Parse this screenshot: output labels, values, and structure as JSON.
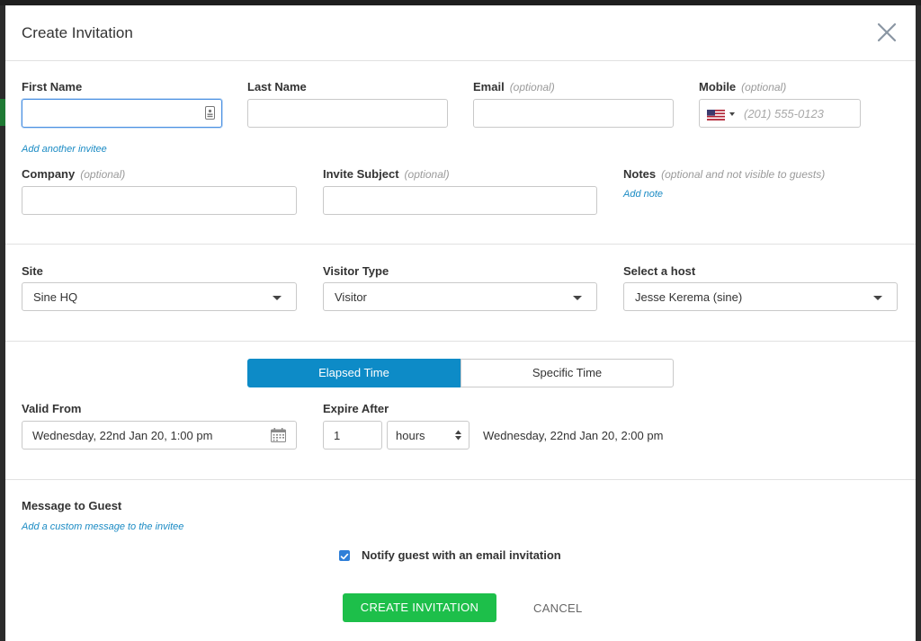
{
  "modal": {
    "title": "Create Invitation"
  },
  "invitee": {
    "first_name_label": "First Name",
    "last_name_label": "Last Name",
    "email_label": "Email",
    "email_optional": "(optional)",
    "mobile_label": "Mobile",
    "mobile_optional": "(optional)",
    "mobile_placeholder": "(201) 555-0123",
    "add_another": "Add another invitee"
  },
  "details": {
    "company_label": "Company",
    "company_optional": "(optional)",
    "subject_label": "Invite Subject",
    "subject_optional": "(optional)",
    "notes_label": "Notes",
    "notes_optional": "(optional and not visible to guests)",
    "add_note": "Add note"
  },
  "selection": {
    "site_label": "Site",
    "site_value": "Sine HQ",
    "visitor_type_label": "Visitor Type",
    "visitor_type_value": "Visitor",
    "host_label": "Select a host",
    "host_value": "Jesse Kerema (sine)"
  },
  "timing": {
    "tab_elapsed": "Elapsed Time",
    "tab_specific": "Specific Time",
    "valid_from_label": "Valid From",
    "valid_from_value": "Wednesday, 22nd Jan 20, 1:00 pm",
    "expire_after_label": "Expire After",
    "expire_amount": "1",
    "expire_unit": "hours",
    "expire_result": "Wednesday, 22nd Jan 20, 2:00 pm"
  },
  "message": {
    "label": "Message to Guest",
    "add_custom": "Add a custom message to the invitee",
    "notify_label": "Notify guest with an email invitation",
    "notify_checked": true
  },
  "actions": {
    "create": "CREATE INVITATION",
    "cancel": "CANCEL"
  },
  "colors": {
    "accent": "#0d8bc7",
    "create": "#1dbf4a",
    "link": "#1b8bc4"
  }
}
